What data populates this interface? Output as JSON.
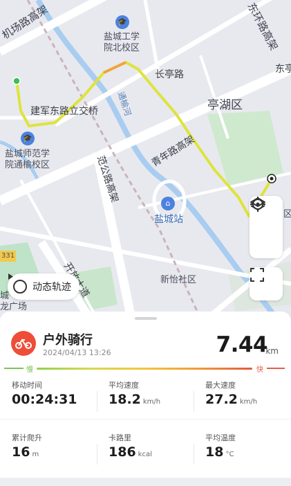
{
  "map": {
    "labels": {
      "jichang": "机场路高架",
      "dongfan": "东环路高架",
      "yancheng_gongxue": "盐城工学\n院北校区",
      "changting": "长亭路",
      "dong": "东亭",
      "tinghu": "亭湖区",
      "jianjun": "建军东路立交桥",
      "river": "通榆河",
      "shifan": "盐城师范学\n院通榆校区",
      "qingnian": "青年路高架",
      "fangong": "范公路高架",
      "station": "盐城站",
      "xinyi": "新怡社区",
      "kaifang": "开放大道",
      "edge331": "331",
      "edge_city": "城",
      "edge_plaza": "龙广场",
      "edge_qu": "区"
    }
  },
  "controls": {
    "track_label": "动态轨迹",
    "locate_icon": "locate-icon",
    "layers_icon": "layers-icon",
    "fullscreen_icon": "fullscreen-icon"
  },
  "summary": {
    "sport": "户外骑行",
    "date": "2024/04/13 13:26",
    "distance": "7.44",
    "distance_unit": "km",
    "slow": "慢",
    "fast": "快"
  },
  "stats": [
    {
      "label": "移动时间",
      "value": "00:24:31",
      "unit": ""
    },
    {
      "label": "平均速度",
      "value": "18.2",
      "unit": "km/h"
    },
    {
      "label": "最大速度",
      "value": "27.2",
      "unit": "km/h"
    },
    {
      "label": "累计爬升",
      "value": "16",
      "unit": "m"
    },
    {
      "label": "卡路里",
      "value": "186",
      "unit": "kcal"
    },
    {
      "label": "平均温度",
      "value": "18",
      "unit": "°C"
    }
  ],
  "colors": {
    "accent": "#ee4d38",
    "slow": "#7cc454",
    "fast": "#e55b46",
    "route": "#d8e13a"
  }
}
